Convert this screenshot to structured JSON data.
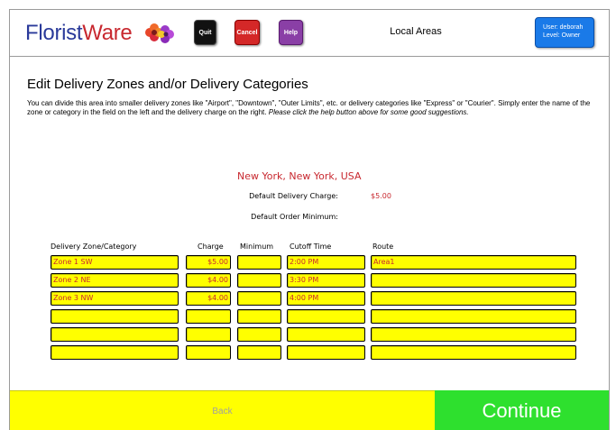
{
  "header": {
    "logo_part1": "Florist",
    "logo_part2": "Ware",
    "quit_label": "Quit",
    "cancel_label": "Cancel",
    "help_label": "Help",
    "area_title": "Local Areas",
    "user_line": "User: deborah",
    "level_line": "Level: Owner"
  },
  "main": {
    "title": "Edit Delivery Zones and/or Delivery Categories",
    "description": "You can divide this area into smaller delivery zones like \"Airport\", \"Downtown\", \"Outer Limits\", etc. or delivery categories like \"Express\" or \"Courier\". Simply enter the name of the zone or category in the field on the left and the delivery charge on the right.",
    "description_italic": "Please click the help button above for some good suggestions.",
    "location": "New York, New York, USA",
    "default_charge_label": "Default Delivery Charge:",
    "default_charge_value": "$5.00",
    "default_minimum_label": "Default Order Minimum:",
    "default_minimum_value": ""
  },
  "table": {
    "headers": {
      "zone": "Delivery Zone/Category",
      "charge": "Charge",
      "minimum": "Minimum",
      "cutoff": "Cutoff Time",
      "route": "Route"
    },
    "rows": [
      {
        "zone": "Zone 1 SW",
        "charge": "$5.00",
        "minimum": "",
        "cutoff": "2:00 PM",
        "route": "Area1"
      },
      {
        "zone": "Zone 2 NE",
        "charge": "$4.00",
        "minimum": "",
        "cutoff": "3:30 PM",
        "route": ""
      },
      {
        "zone": "Zone 3 NW",
        "charge": "$4.00",
        "minimum": "",
        "cutoff": "4:00 PM",
        "route": ""
      },
      {
        "zone": "",
        "charge": "",
        "minimum": "",
        "cutoff": "",
        "route": ""
      },
      {
        "zone": "",
        "charge": "",
        "minimum": "",
        "cutoff": "",
        "route": ""
      },
      {
        "zone": "",
        "charge": "",
        "minimum": "",
        "cutoff": "",
        "route": ""
      }
    ]
  },
  "footer": {
    "back_label": "Back",
    "continue_label": "Continue"
  },
  "colors": {
    "accent_red": "#c8282f",
    "field_yellow": "#ffff00",
    "continue_green": "#2ee02e",
    "user_blue": "#1a7ae8"
  },
  "icons": {
    "logo_flower": "flower-icon"
  }
}
